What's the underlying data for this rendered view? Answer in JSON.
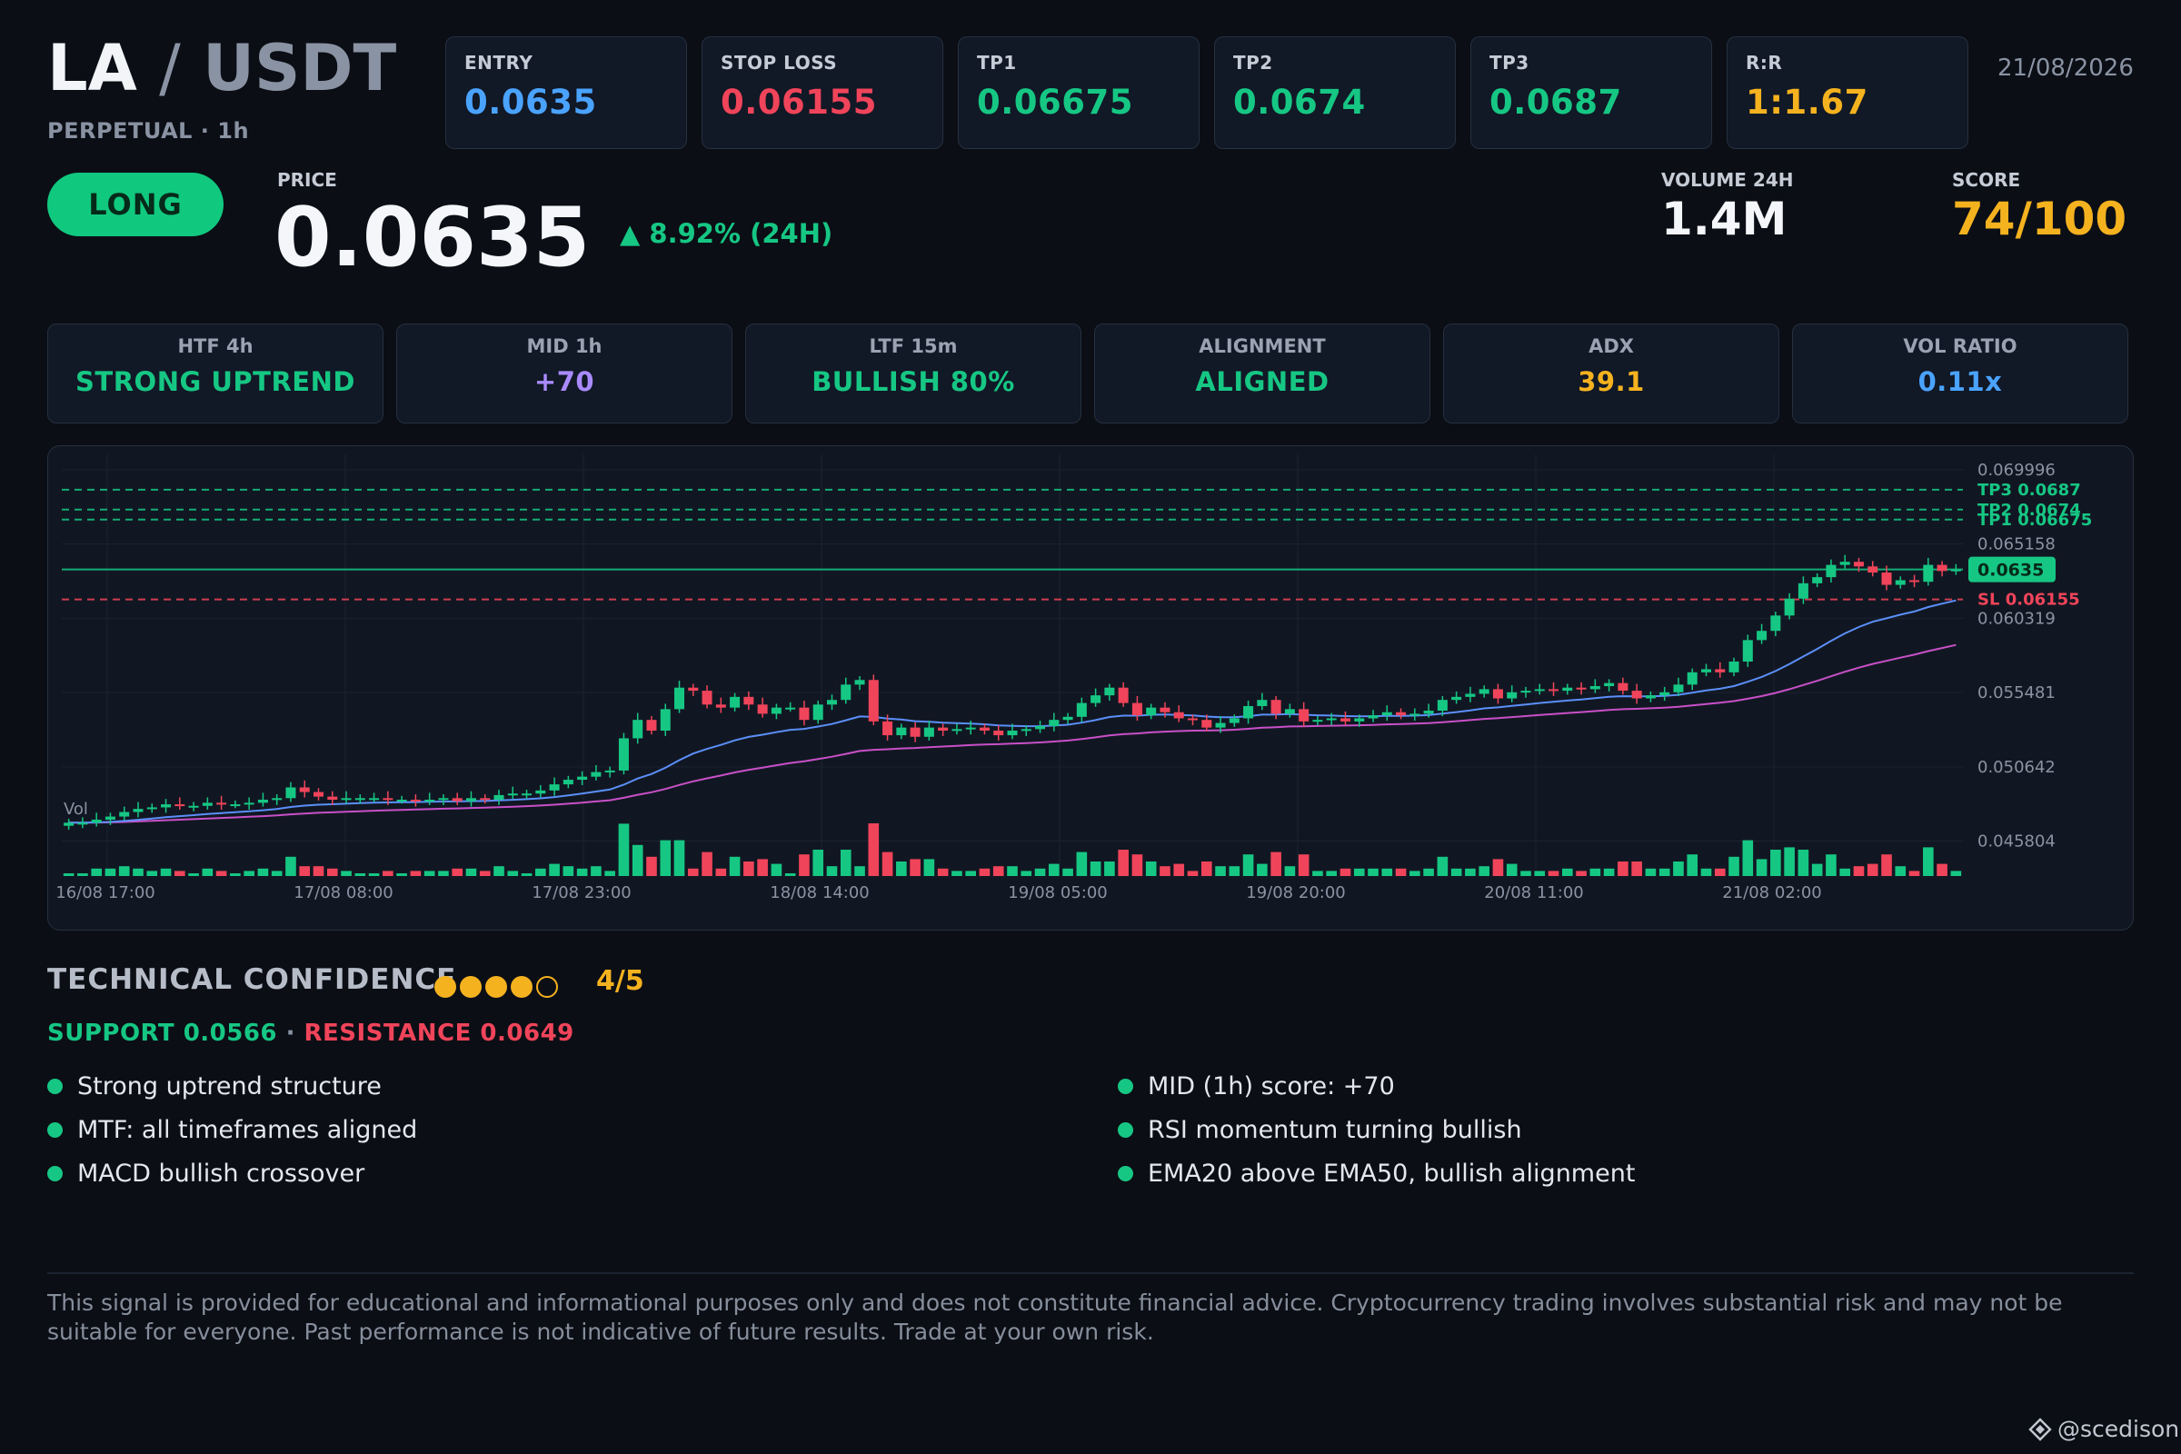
{
  "header": {
    "base": "LA",
    "separator": "/",
    "quote": "USDT",
    "subtitle": "PERPETUAL · 1h",
    "date": "21/08/2026"
  },
  "stats": [
    {
      "label": "ENTRY",
      "value": "0.0635",
      "color": "#4aa3ff"
    },
    {
      "label": "STOP LOSS",
      "value": "0.06155",
      "color": "#f0445a"
    },
    {
      "label": "TP1",
      "value": "0.06675",
      "color": "#16c784"
    },
    {
      "label": "TP2",
      "value": "0.0674",
      "color": "#16c784"
    },
    {
      "label": "TP3",
      "value": "0.0687",
      "color": "#16c784"
    },
    {
      "label": "R:R",
      "value": "1:1.67",
      "color": "#f5b21f"
    }
  ],
  "signal": {
    "direction": "LONG"
  },
  "price": {
    "label": "PRICE",
    "value": "0.0635",
    "change": "▲ 8.92% (24H)"
  },
  "volume": {
    "label": "VOLUME 24H",
    "value": "1.4M"
  },
  "score": {
    "label": "SCORE",
    "value": "74/100"
  },
  "indicators": [
    {
      "label": "HTF 4h",
      "value": "STRONG UPTREND",
      "color": "#16c784"
    },
    {
      "label": "MID 1h",
      "value": "+70",
      "color": "#a98bff"
    },
    {
      "label": "LTF 15m",
      "value": "BULLISH 80%",
      "color": "#16c784"
    },
    {
      "label": "ALIGNMENT",
      "value": "ALIGNED",
      "color": "#16c784"
    },
    {
      "label": "ADX",
      "value": "39.1",
      "color": "#f5b21f"
    },
    {
      "label": "VOL RATIO",
      "value": "0.11x",
      "color": "#4aa3ff"
    }
  ],
  "chart_data": {
    "type": "candlestick",
    "y_ticks": [
      "0.069996",
      "0.065158",
      "0.060319",
      "0.055481",
      "0.050642",
      "0.045804"
    ],
    "x_ticks": [
      "16/08 17:00",
      "17/08 08:00",
      "17/08 23:00",
      "18/08 14:00",
      "19/08 05:00",
      "19/08 20:00",
      "20/08 11:00",
      "21/08 02:00"
    ],
    "ylim": [
      0.044,
      0.071
    ],
    "volume_label": "Vol",
    "levels": [
      {
        "label": "TP3 0.0687",
        "value": 0.0687,
        "color": "#16c784"
      },
      {
        "label": "TP2 0.0674",
        "value": 0.0674,
        "color": "#16c784"
      },
      {
        "label": "TP1 0.06675",
        "value": 0.06675,
        "color": "#16c784"
      },
      {
        "label": "SL 0.06155",
        "value": 0.06155,
        "color": "#f0445a"
      }
    ],
    "entry": {
      "label": "0.0635",
      "value": 0.0635
    },
    "colors": {
      "up": "#16c784",
      "down": "#f0445a",
      "ema20": "#5b8ff9",
      "ema50": "#c850c8"
    },
    "closes": [
      0.047,
      0.047,
      0.0472,
      0.0474,
      0.0477,
      0.0479,
      0.048,
      0.0482,
      0.0481,
      0.0481,
      0.0483,
      0.0482,
      0.0482,
      0.0483,
      0.0485,
      0.0486,
      0.0493,
      0.049,
      0.0487,
      0.0485,
      0.0486,
      0.0486,
      0.0486,
      0.0485,
      0.0485,
      0.0484,
      0.0485,
      0.0486,
      0.0484,
      0.0486,
      0.0485,
      0.0488,
      0.0489,
      0.0489,
      0.0491,
      0.0495,
      0.0498,
      0.05,
      0.0503,
      0.0504,
      0.0525,
      0.0537,
      0.053,
      0.0544,
      0.0558,
      0.0556,
      0.0547,
      0.0545,
      0.0552,
      0.0547,
      0.0541,
      0.0545,
      0.0545,
      0.0537,
      0.0547,
      0.055,
      0.056,
      0.0563,
      0.0536,
      0.0527,
      0.0532,
      0.0526,
      0.0532,
      0.053,
      0.0531,
      0.0532,
      0.053,
      0.0527,
      0.053,
      0.0531,
      0.0533,
      0.0537,
      0.0539,
      0.0548,
      0.0553,
      0.0558,
      0.0548,
      0.054,
      0.0545,
      0.0542,
      0.0538,
      0.0537,
      0.0532,
      0.0535,
      0.0538,
      0.0546,
      0.055,
      0.0541,
      0.0544,
      0.0536,
      0.0537,
      0.0538,
      0.0536,
      0.0538,
      0.054,
      0.0542,
      0.054,
      0.0541,
      0.0543,
      0.055,
      0.0552,
      0.0554,
      0.0557,
      0.0551,
      0.0555,
      0.0556,
      0.0557,
      0.0556,
      0.0558,
      0.0557,
      0.0559,
      0.0561,
      0.0556,
      0.0551,
      0.0553,
      0.0555,
      0.056,
      0.0568,
      0.057,
      0.0568,
      0.0575,
      0.0589,
      0.0595,
      0.0605,
      0.0616,
      0.0626,
      0.063,
      0.0638,
      0.064,
      0.0637,
      0.0633,
      0.0625,
      0.0628,
      0.0627,
      0.0638,
      0.0634,
      0.0635
    ]
  },
  "confidence": {
    "title": "TECHNICAL CONFIDENCE",
    "filled": 4,
    "total": 5,
    "score_text": "4/5",
    "support": "SUPPORT 0.0566",
    "separator": " · ",
    "resistance": "RESISTANCE 0.0649"
  },
  "reasons": {
    "left": [
      "Strong uptrend structure",
      "MTF: all timeframes aligned",
      "MACD bullish crossover"
    ],
    "right": [
      "MID (1h) score: +70",
      "RSI momentum turning bullish",
      "EMA20 above EMA50, bullish alignment"
    ]
  },
  "disclaimer": "This signal is provided for educational and informational purposes only and does not constitute financial advice. Cryptocurrency trading involves substantial risk and may not be suitable for everyone. Past performance is not indicative of future results. Trade at your own risk.",
  "watermark": {
    "handle": "@scedison",
    "icon": "diamond-logo-icon"
  }
}
